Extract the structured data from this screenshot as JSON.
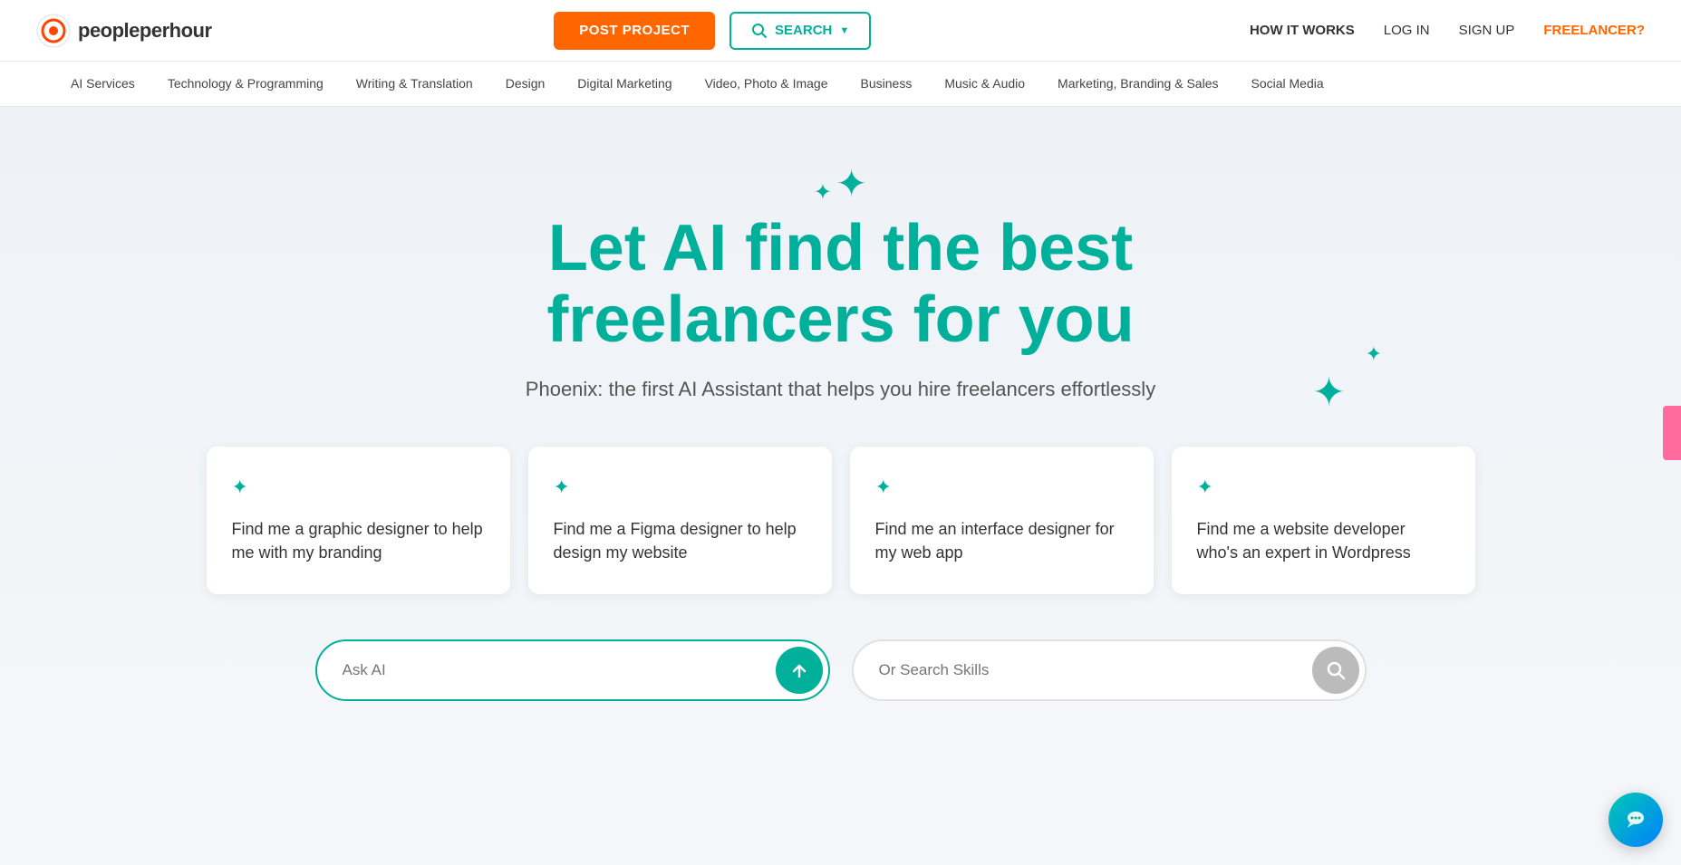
{
  "header": {
    "logo_text_start": "peopleperhour",
    "post_project_label": "POST PROJECT",
    "search_label": "SEARCH",
    "how_it_works_label": "HOW IT WORKS",
    "login_label": "LOG IN",
    "signup_label": "SIGN UP",
    "freelancer_label": "FREELANCER?"
  },
  "categories": {
    "items": [
      {
        "label": "AI Services"
      },
      {
        "label": "Technology & Programming"
      },
      {
        "label": "Writing & Translation"
      },
      {
        "label": "Design"
      },
      {
        "label": "Digital Marketing"
      },
      {
        "label": "Video, Photo & Image"
      },
      {
        "label": "Business"
      },
      {
        "label": "Music & Audio"
      },
      {
        "label": "Marketing, Branding & Sales"
      },
      {
        "label": "Social Media"
      }
    ]
  },
  "hero": {
    "title_line1": "Let AI find the best",
    "title_line2": "freelancers for you",
    "subtitle": "Phoenix: the first AI Assistant that helps you hire freelancers effortlessly"
  },
  "suggestion_cards": [
    {
      "text": "Find me a graphic designer to help me with my branding"
    },
    {
      "text": "Find me a Figma designer to help design my website"
    },
    {
      "text": "Find me an interface designer for my web app"
    },
    {
      "text": "Find me a website developer who's an expert in Wordpress"
    }
  ],
  "ai_input": {
    "placeholder": "Ask AI"
  },
  "skills_input": {
    "placeholder": "Or Search Skills"
  }
}
